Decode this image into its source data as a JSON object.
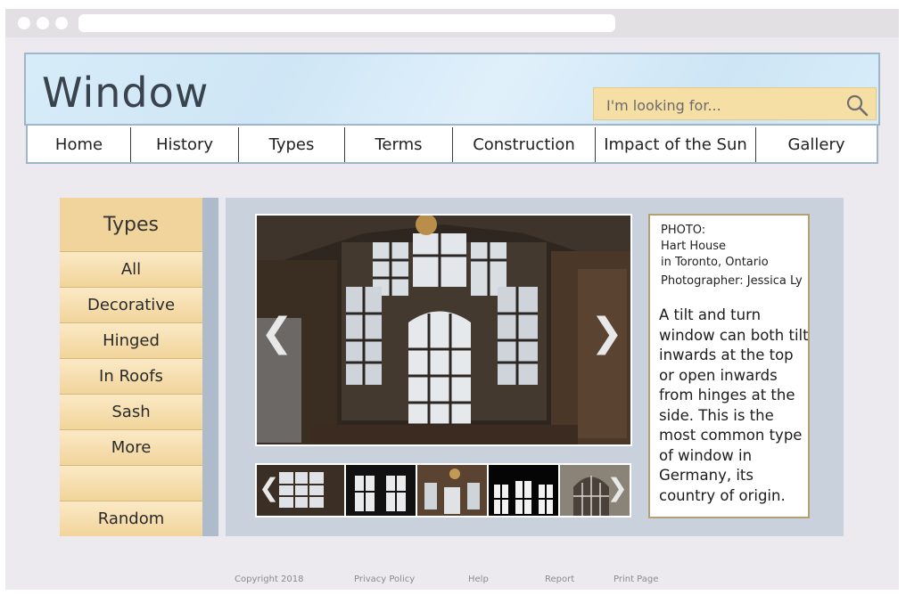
{
  "site": {
    "title": "Window"
  },
  "search": {
    "placeholder": "I'm looking for..."
  },
  "nav": {
    "items": [
      "Home",
      "History",
      "Types",
      "Terms",
      "Construction",
      "Impact of the Sun",
      "Gallery"
    ]
  },
  "sidebar": {
    "heading": "Types",
    "items": [
      "All",
      "Decorative",
      "Hinged",
      "In Roofs",
      "Sash",
      "More",
      "",
      "Random"
    ]
  },
  "gallery": {
    "prev_icon": "chevron-left-icon",
    "next_icon": "chevron-right-icon"
  },
  "info": {
    "label": "PHOTO:",
    "place": "Hart House",
    "location": "in Toronto, Ontario",
    "photographer": "Photographer: Jessica Ly",
    "description": "A tilt and turn window can both tilt inwards at the top or open inwards from hinges at the side. This is the most common type of window in Germany, its country of origin."
  },
  "footer": {
    "copyright": "Copyright 2018",
    "privacy": "Privacy Policy",
    "help": "Help",
    "report": "Report",
    "print": "Print Page"
  },
  "colors": {
    "accent": "#f1d49c",
    "panel": "#c9d1dd",
    "border": "#9fb6c9"
  }
}
